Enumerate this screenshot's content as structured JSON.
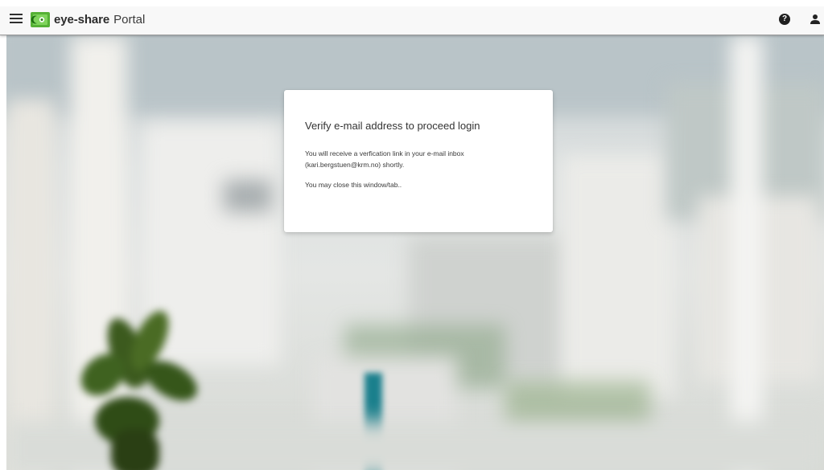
{
  "app": {
    "brand_name": "eye-share",
    "brand_suffix": "Portal",
    "help_symbol": "?",
    "icons": {
      "menu": "hamburger-menu-icon",
      "logo": "eye-share-logo",
      "help": "question-circle-icon",
      "user": "user-icon"
    },
    "colors": {
      "logo_green": "#55b135",
      "topbar_bg": "#f8f8f8"
    }
  },
  "dialog": {
    "title": "Verify e-mail address to proceed login",
    "message_line1": "You will receive a verfication link in your e-mail inbox (kari.bergstuen@krm.no) shortly.",
    "message_line2": "You may close this window/tab.."
  }
}
